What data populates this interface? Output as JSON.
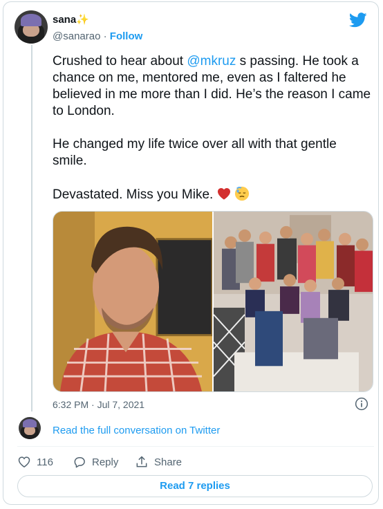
{
  "author": {
    "name": "sana",
    "name_emoji": "✨",
    "handle": "@sanarao",
    "separator": "·",
    "follow_label": "Follow"
  },
  "tweet": {
    "p1_before": "Crushed to hear about ",
    "p1_mention": "@mkruz",
    "p1_after": " s passing. He took a chance on me, mentored me, even as I faltered he believed in me more than I did. He’s the reason I came to London.",
    "p2": "He changed my life twice over all with that gentle smile.",
    "p3": "Devastated. Miss you Mike.",
    "emojis": [
      "red-heart-icon",
      "sad-relieved-face-icon"
    ]
  },
  "media": {
    "images": [
      "portrait-photo",
      "group-photo"
    ]
  },
  "meta": {
    "timestamp": "6:32 PM · Jul 7, 2021"
  },
  "conversation": {
    "read_full_label": "Read the full conversation on Twitter"
  },
  "actions": {
    "like_count": "116",
    "reply_label": "Reply",
    "share_label": "Share"
  },
  "footer": {
    "read_replies_label": "Read 7 replies"
  },
  "colors": {
    "accent": "#1d9bf0",
    "heart": "#f91880",
    "secondary_text": "#536471"
  }
}
